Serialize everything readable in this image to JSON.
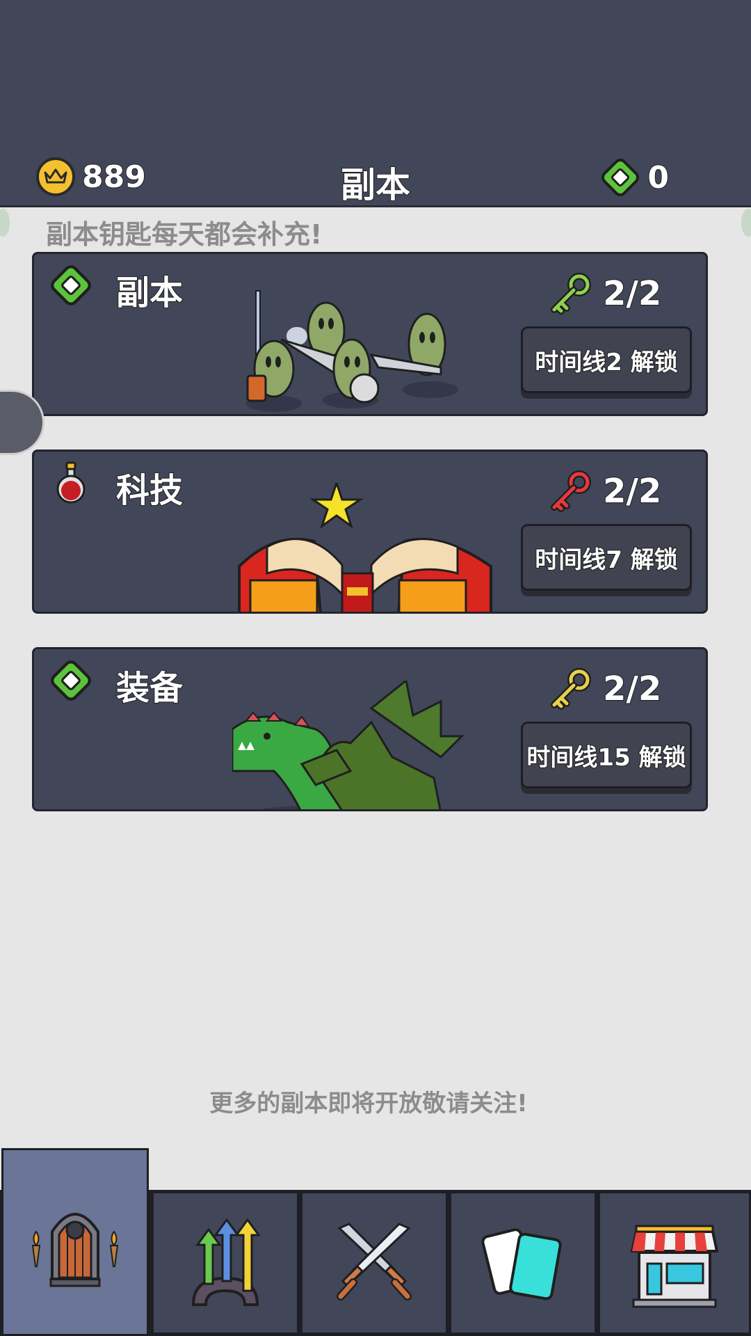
{
  "header": {
    "title": "副本",
    "coins": "889",
    "gems": "0"
  },
  "notice": "副本钥匙每天都会补充!",
  "cards": [
    {
      "title": "副本",
      "keys": "2/2",
      "unlock": "时间线2 解锁",
      "icon": "green-gem-icon",
      "key_color": "#8fd14f",
      "art": "soldiers-art"
    },
    {
      "title": "科技",
      "keys": "2/2",
      "unlock": "时间线7 解锁",
      "icon": "potion-icon",
      "key_color": "#e8383c",
      "art": "book-art"
    },
    {
      "title": "装备",
      "keys": "2/2",
      "unlock": "时间线15 解锁",
      "icon": "green-gem-icon",
      "key_color": "#e8d14a",
      "art": "dragon-art"
    }
  ],
  "footer_note": "更多的副本即将开放敬请关注!",
  "tabs": [
    {
      "icon": "dungeon-door-icon",
      "active": true
    },
    {
      "icon": "upgrade-arrows-icon",
      "active": false
    },
    {
      "icon": "crossed-swords-icon",
      "active": false
    },
    {
      "icon": "cards-icon",
      "active": false
    },
    {
      "icon": "shop-icon",
      "active": false
    }
  ],
  "colors": {
    "topbar": "#424659",
    "card": "#424659",
    "background": "#e6e6e6",
    "active_tab": "#6a7597",
    "gem_green": "#5cc43c",
    "coin_gold": "#f5c02f"
  }
}
